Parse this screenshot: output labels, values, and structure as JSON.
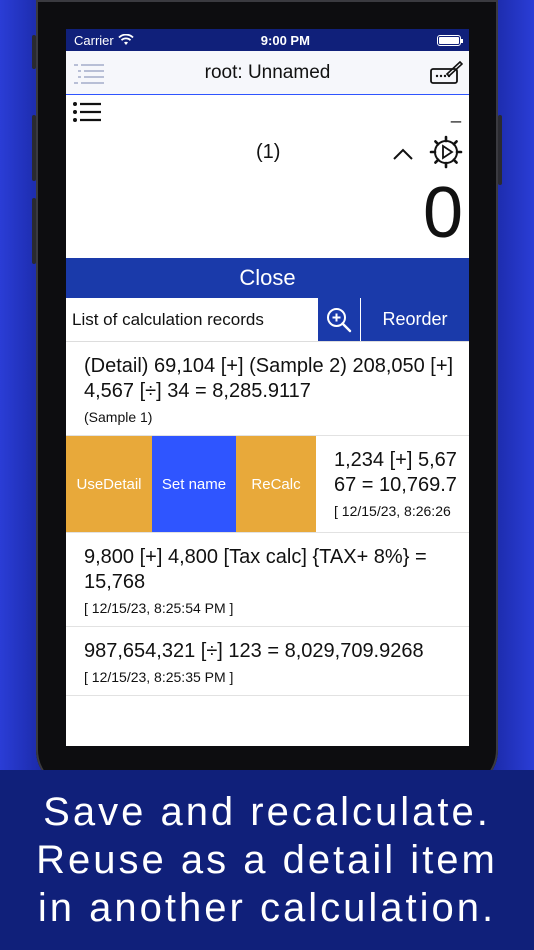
{
  "status_bar": {
    "carrier": "Carrier",
    "time": "9:00 PM"
  },
  "nav": {
    "title": "root: Unnamed"
  },
  "calculator": {
    "expression_marker": "(1)",
    "display_value": "0",
    "minus_mark": "_"
  },
  "close_bar": {
    "label": "Close"
  },
  "toolbar": {
    "label": "List of calculation records",
    "reorder_label": "Reorder"
  },
  "records": [
    {
      "formula": "(Detail) 69,104 [+] (Sample 2) 208,050 [+] 4,567 [÷] 34 = 8,285.9117",
      "meta": "(Sample 1)"
    },
    {
      "formula": "9,800 [+] 4,800 [Tax calc] {TAX+ 8%} = 15,768",
      "meta": "[ 12/15/23, 8:25:54 PM ]"
    },
    {
      "formula": "987,654,321 [÷] 123 = 8,029,709.9268",
      "meta": "[ 12/15/23, 8:25:35 PM ]"
    }
  ],
  "swiped_record": {
    "actions": {
      "use_detail": "UseDetail",
      "set_name": "Set name",
      "recalc": "ReCalc"
    },
    "formula_line1": "1,234 [+] 5,67",
    "formula_line2": "67 = 10,769.7",
    "meta": "[ 12/15/23, 8:26:26"
  },
  "caption": {
    "line1": "Save and recalculate.",
    "line2": "Reuse as a detail item",
    "line3": "in another calculation."
  },
  "colors": {
    "brand_blue": "#1a3aaa",
    "action_orange": "#e8a93a",
    "action_blue": "#2f55ff",
    "band_navy": "#10207a"
  }
}
